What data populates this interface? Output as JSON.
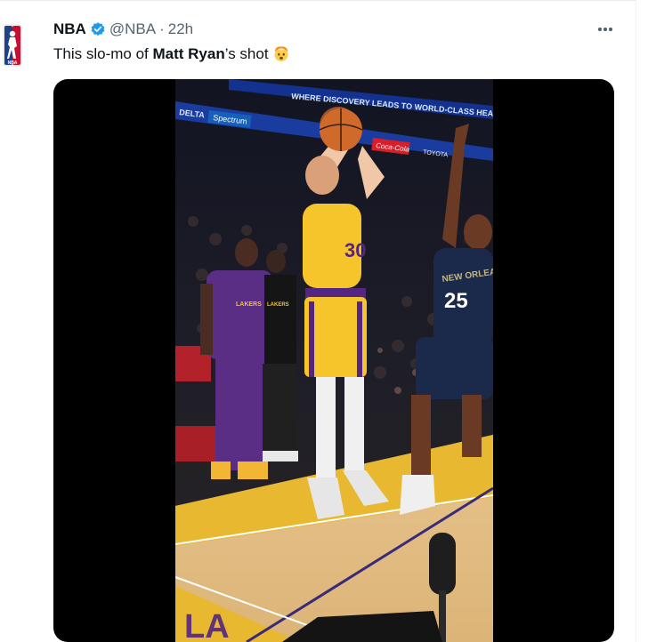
{
  "tweet": {
    "author_name": "NBA",
    "handle": "@NBA",
    "separator": "·",
    "time": "22h",
    "text_prefix": "This slo-mo of ",
    "text_bold": "Matt Ryan",
    "text_suffix": "’s shot",
    "emoji": "exploding-head-emoji"
  },
  "video": {
    "arena_banner_top": "WHERE DISCOVERY LEADS TO WORLD-CLASS HEALTH CARE",
    "sponsor_delta": "DELTA",
    "sponsor_spectrum": "Spectrum",
    "sponsor_cocacola": "Coca-Cola",
    "sponsor_toyota": "TOYOTA",
    "shooter_number": "30",
    "defender_team": "NEW ORLEANS",
    "defender_number": "25",
    "bench_shirt_text": "LAKERS",
    "bench_player_shirt": "LAKERS"
  },
  "colors": {
    "verified_blue": "#1d9bf0",
    "lakers_gold": "#f6c42b",
    "lakers_purple": "#552583",
    "pelicans_navy": "#1b2a4a"
  }
}
